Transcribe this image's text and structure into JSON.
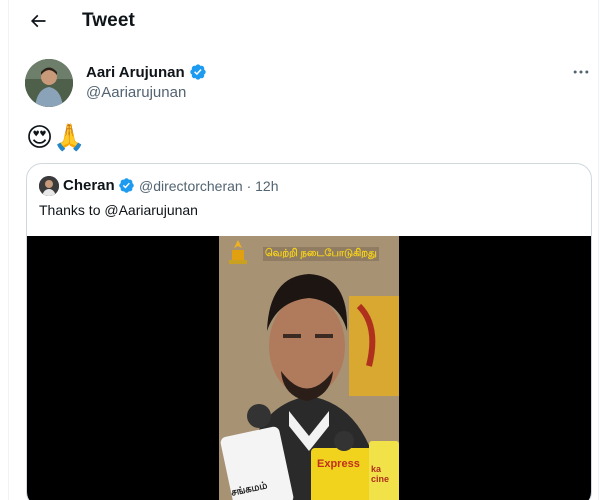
{
  "header": {
    "title": "Tweet",
    "back_icon": "arrow-left-icon"
  },
  "tweet": {
    "author_name": "Aari Arujunan",
    "author_handle": "@Aariarujunan",
    "verified_color": "#1d9bf0",
    "text": "😍🙏",
    "more_icon": "more-horizontal-icon"
  },
  "quoted": {
    "name": "Cheran",
    "handle_time": "@directorcheran · 12h",
    "text": "Thanks to @Aariarujunan",
    "video": {
      "caption": "வெற்றி நடைபோடுகிறது",
      "mic_labels": [
        "சங்கமம்",
        "Express",
        "ka cine"
      ]
    }
  },
  "colors": {
    "text_primary": "#0f1419",
    "text_secondary": "#536471",
    "border": "#cfd9de",
    "accent": "#1d9bf0"
  }
}
